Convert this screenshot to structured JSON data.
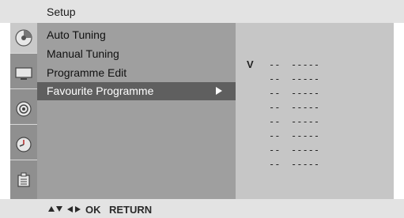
{
  "header": {
    "title": "Setup"
  },
  "sidebar": {
    "icons": [
      {
        "name": "setup-icon",
        "active": true
      },
      {
        "name": "picture-icon",
        "active": false
      },
      {
        "name": "audio-icon",
        "active": false
      },
      {
        "name": "time-icon",
        "active": false
      },
      {
        "name": "option-icon",
        "active": false
      }
    ]
  },
  "menu": {
    "items": [
      {
        "label": "Auto Tuning"
      },
      {
        "label": "Manual Tuning"
      },
      {
        "label": "Programme Edit"
      },
      {
        "label": "Favourite Programme",
        "selected": true
      }
    ]
  },
  "favourites": {
    "v_label": "V",
    "rows": [
      {
        "num": "--",
        "name": "-----"
      },
      {
        "num": "--",
        "name": "-----"
      },
      {
        "num": "--",
        "name": "-----"
      },
      {
        "num": "--",
        "name": "-----"
      },
      {
        "num": "--",
        "name": "-----"
      },
      {
        "num": "--",
        "name": "-----"
      },
      {
        "num": "--",
        "name": "-----"
      },
      {
        "num": "--",
        "name": "-----"
      }
    ]
  },
  "footer": {
    "ok_label": "OK",
    "return_label": "RETURN"
  },
  "colors": {
    "header_bg": "#e3e3e3",
    "menu_bg": "#9f9f9f",
    "selected_bg": "#5f5f5f",
    "sub_panel_bg": "#c6c6c6",
    "icon_column_bg": "#8f8f8f"
  }
}
